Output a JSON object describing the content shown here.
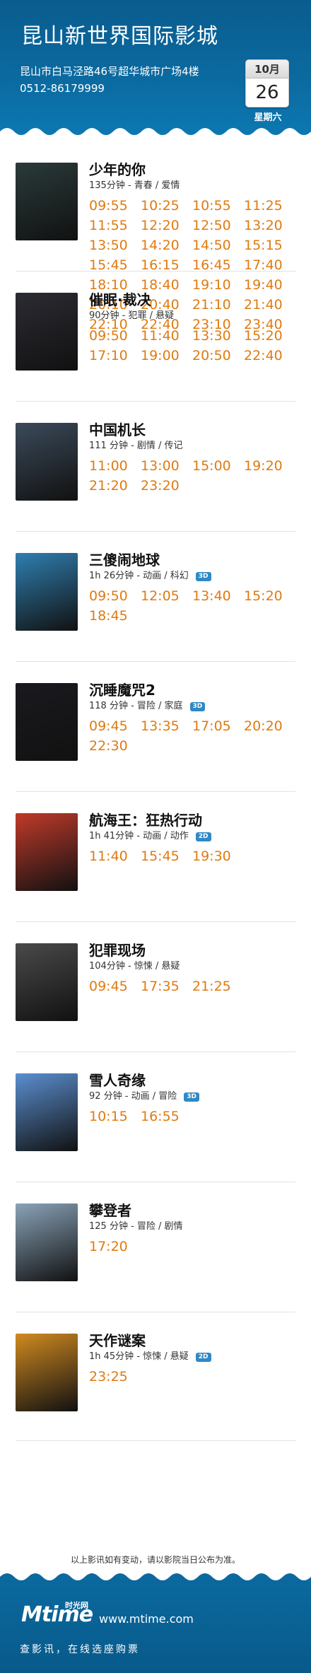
{
  "header": {
    "cinema_name": "昆山新世界国际影城",
    "address": "昆山市白马泾路46号超华城市广场4楼",
    "phone": "0512-86179999",
    "calendar": {
      "month": "10月",
      "day": "26",
      "weekday": "星期六"
    }
  },
  "films": [
    {
      "title": "少年的你",
      "meta": "135分钟 - 青春 / 爱情",
      "tag": "",
      "poster_color": "#2a3a3a",
      "times": [
        "09:55",
        "10:25",
        "10:55",
        "11:25",
        "11:55",
        "12:20",
        "12:50",
        "13:20",
        "13:50",
        "14:20",
        "14:50",
        "15:15",
        "15:45",
        "16:15",
        "16:45",
        "17:40",
        "18:10",
        "18:40",
        "19:10",
        "19:40",
        "20:10",
        "20:40",
        "21:10",
        "21:40",
        "22:10",
        "22:40",
        "23:10",
        "23:40"
      ]
    },
    {
      "title": "催眠·裁决",
      "meta": "90分钟 - 犯罪 / 悬疑",
      "tag": "",
      "poster_color": "#2b2b33",
      "times": [
        "09:50",
        "11:40",
        "13:30",
        "15:20",
        "17:10",
        "19:00",
        "20:50",
        "22:40"
      ]
    },
    {
      "title": "中国机长",
      "meta": "111 分钟 - 剧情 / 传记",
      "tag": "",
      "poster_color": "#3b4a5a",
      "times": [
        "11:00",
        "13:00",
        "15:00",
        "19:20",
        "21:20",
        "23:20"
      ]
    },
    {
      "title": "三傻闹地球",
      "meta": "1h 26分钟 - 动画 / 科幻",
      "tag": "3D",
      "poster_color": "#2f7fb0",
      "times": [
        "09:50",
        "12:05",
        "13:40",
        "15:20",
        "18:45"
      ]
    },
    {
      "title": "沉睡魔咒2",
      "meta": "118 分钟 - 冒险 / 家庭",
      "tag": "3D",
      "poster_color": "#1a1a1f",
      "times": [
        "09:45",
        "13:35",
        "17:05",
        "20:20",
        "22:30"
      ]
    },
    {
      "title": "航海王：狂热行动",
      "meta": "1h 41分钟 - 动画 / 动作",
      "tag": "2D",
      "poster_color": "#c03a2a",
      "times": [
        "11:40",
        "15:45",
        "19:30"
      ]
    },
    {
      "title": "犯罪现场",
      "meta": "104分钟 - 惊悚 / 悬疑",
      "tag": "",
      "poster_color": "#4a4a4a",
      "times": [
        "09:45",
        "17:35",
        "21:25"
      ]
    },
    {
      "title": "雪人奇缘",
      "meta": "92 分钟 - 动画 / 冒险",
      "tag": "3D",
      "poster_color": "#5b8fd0",
      "times": [
        "10:15",
        "16:55"
      ]
    },
    {
      "title": "攀登者",
      "meta": "125 分钟 - 冒险 / 剧情",
      "tag": "",
      "poster_color": "#8aa3b8",
      "times": [
        "17:20"
      ]
    },
    {
      "title": "天作谜案",
      "meta": "1h 45分钟 - 惊悚 / 悬疑",
      "tag": "2D",
      "poster_color": "#d08a20",
      "times": [
        "23:25"
      ]
    }
  ],
  "notice": "以上影讯如有变动，请以影院当日公布为准。",
  "footer": {
    "logo": "Mtime",
    "logo_cn": "时光网",
    "website": "www.mtime.com",
    "slogan": "查影讯，在线选座购票"
  }
}
